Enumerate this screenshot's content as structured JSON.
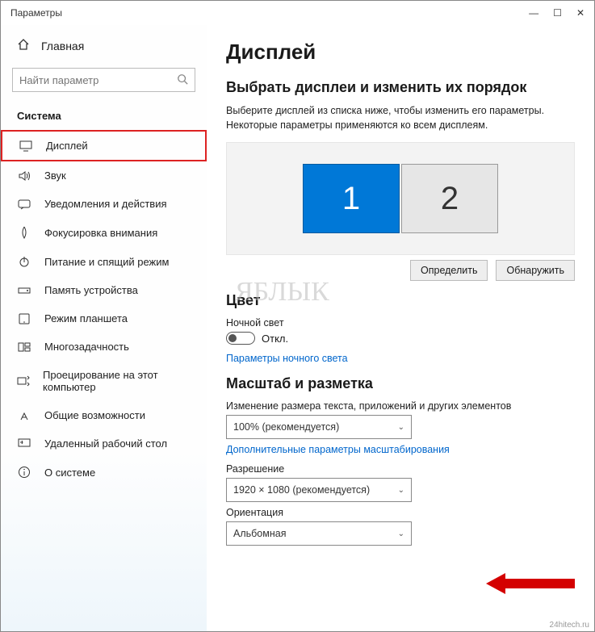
{
  "window": {
    "title": "Параметры"
  },
  "sidebar": {
    "home_label": "Главная",
    "search_placeholder": "Найти параметр",
    "section_label": "Система",
    "items": [
      {
        "label": "Дисплей",
        "selected": true
      },
      {
        "label": "Звук"
      },
      {
        "label": "Уведомления и действия"
      },
      {
        "label": "Фокусировка внимания"
      },
      {
        "label": "Питание и спящий режим"
      },
      {
        "label": "Память устройства"
      },
      {
        "label": "Режим планшета"
      },
      {
        "label": "Многозадачность"
      },
      {
        "label": "Проецирование на этот компьютер"
      },
      {
        "label": "Общие возможности"
      },
      {
        "label": "Удаленный рабочий стол"
      },
      {
        "label": "О системе"
      }
    ]
  },
  "main": {
    "title": "Дисплей",
    "arrange_heading": "Выбрать дисплеи и изменить их порядок",
    "arrange_text": "Выберите дисплей из списка ниже, чтобы изменить его параметры. Некоторые параметры применяются ко всем дисплеям.",
    "monitor1": "1",
    "monitor2": "2",
    "btn_detect": "Определить",
    "btn_identify": "Обнаружить",
    "color_heading": "Цвет",
    "nightlight_label": "Ночной свет",
    "nightlight_state": "Откл.",
    "nightlight_link": "Параметры ночного света",
    "scale_heading": "Масштаб и разметка",
    "scale_label": "Изменение размера текста, приложений и других элементов",
    "scale_value": "100% (рекомендуется)",
    "scale_link": "Дополнительные параметры масштабирования",
    "resolution_label": "Разрешение",
    "resolution_value": "1920 × 1080 (рекомендуется)",
    "orientation_label": "Ориентация",
    "orientation_value": "Альбомная"
  },
  "watermark": "ЯБЛЫК",
  "credit": "24hitech.ru"
}
